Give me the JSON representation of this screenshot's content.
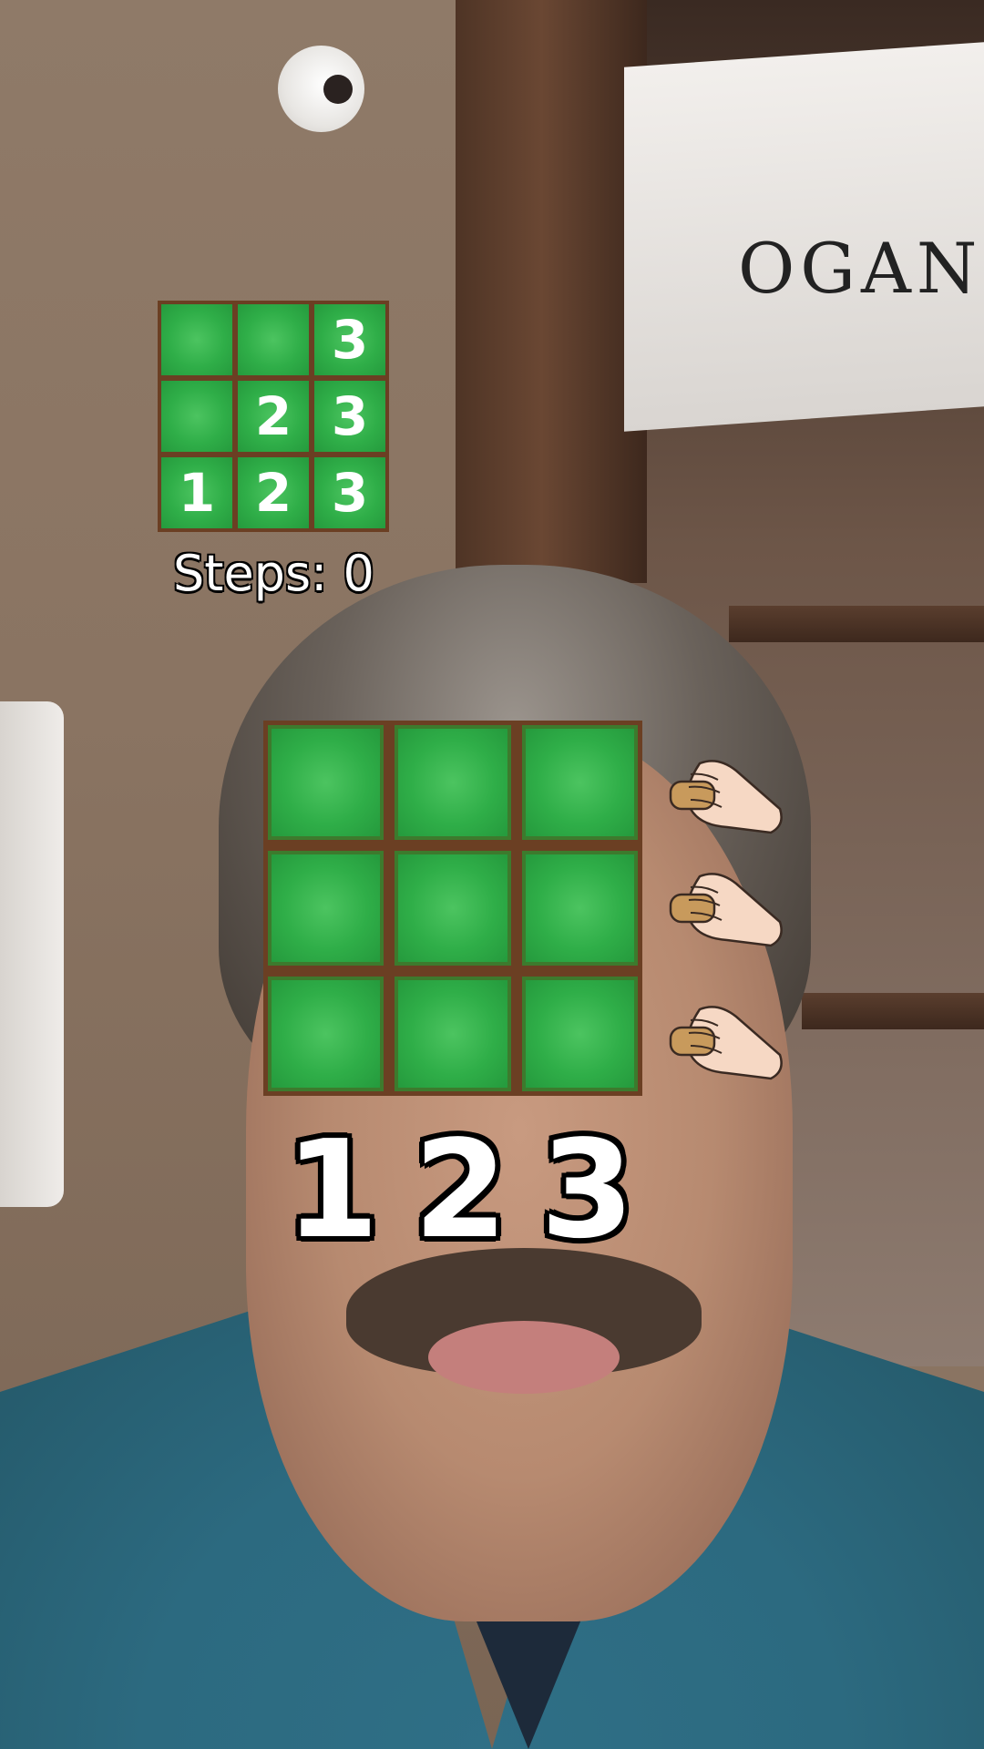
{
  "background": {
    "sign_text": "OGANO"
  },
  "target_grid": {
    "cells": [
      "",
      "",
      "3",
      "",
      "2",
      "3",
      "1",
      "2",
      "3"
    ]
  },
  "steps_label": "Steps: 0",
  "main_grid": {
    "cells": [
      "",
      "",
      "",
      "",
      "",
      "",
      "",
      "",
      ""
    ]
  },
  "column_numbers": [
    "1",
    "2",
    "3"
  ],
  "hand_icons": [
    "hand-pointer-icon",
    "hand-pointer-icon",
    "hand-pointer-icon"
  ],
  "colors": {
    "tile_green": "#2fae48",
    "grid_border_brown": "#6b3f23"
  }
}
